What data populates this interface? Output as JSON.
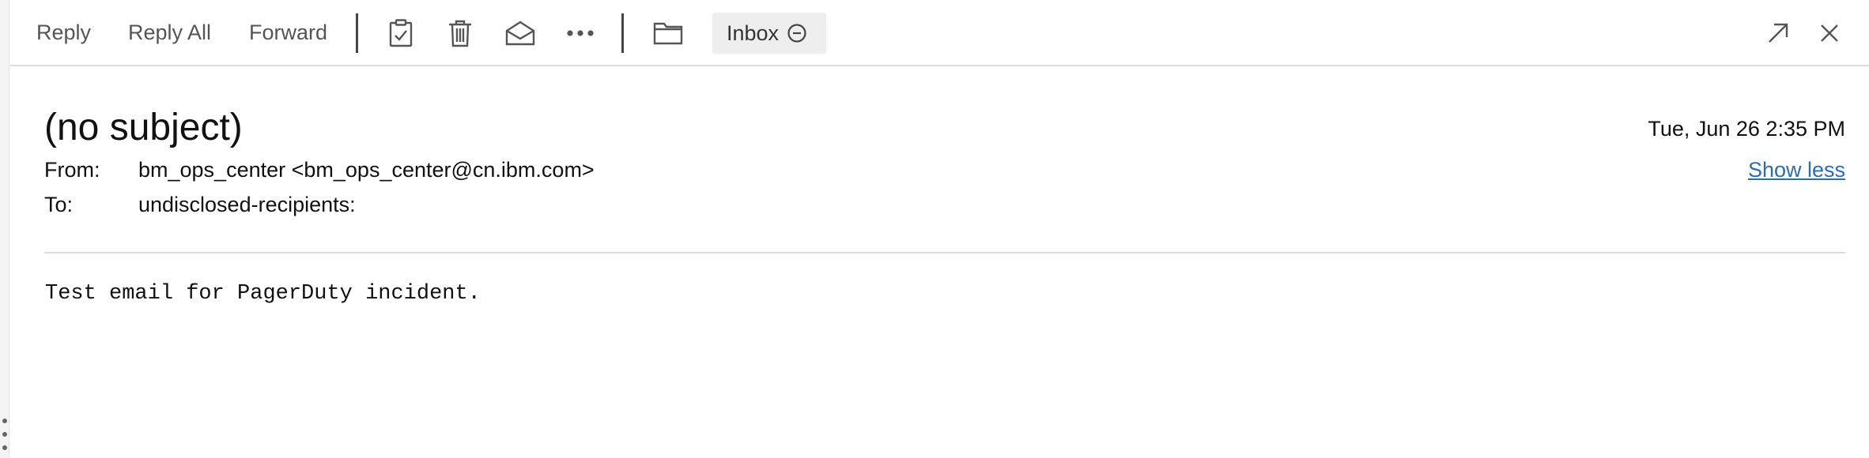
{
  "toolbar": {
    "reply_label": "Reply",
    "reply_all_label": "Reply All",
    "forward_label": "Forward",
    "icons": [
      "clipboard-check-icon",
      "trash-icon",
      "envelope-open-icon",
      "more-icon",
      "folder-icon"
    ],
    "folder_pill_label": "Inbox",
    "folder_pill_icon": "minus-circle-icon",
    "right_icons": [
      "expand-icon",
      "close-icon"
    ]
  },
  "message": {
    "subject": "(no subject)",
    "date": "Tue, Jun 26 2:35 PM",
    "toggle_details_label": "Show less",
    "from_label": "From:",
    "from_value": "bm_ops_center <bm_ops_center@cn.ibm.com>",
    "to_label": "To:",
    "to_value": "undisclosed-recipients:",
    "body": "Test email for PagerDuty incident."
  },
  "colors": {
    "link": "#2a6db5",
    "toolbar_text": "#555555",
    "pill_bg": "#eeeeee",
    "divider": "#dddddd"
  }
}
